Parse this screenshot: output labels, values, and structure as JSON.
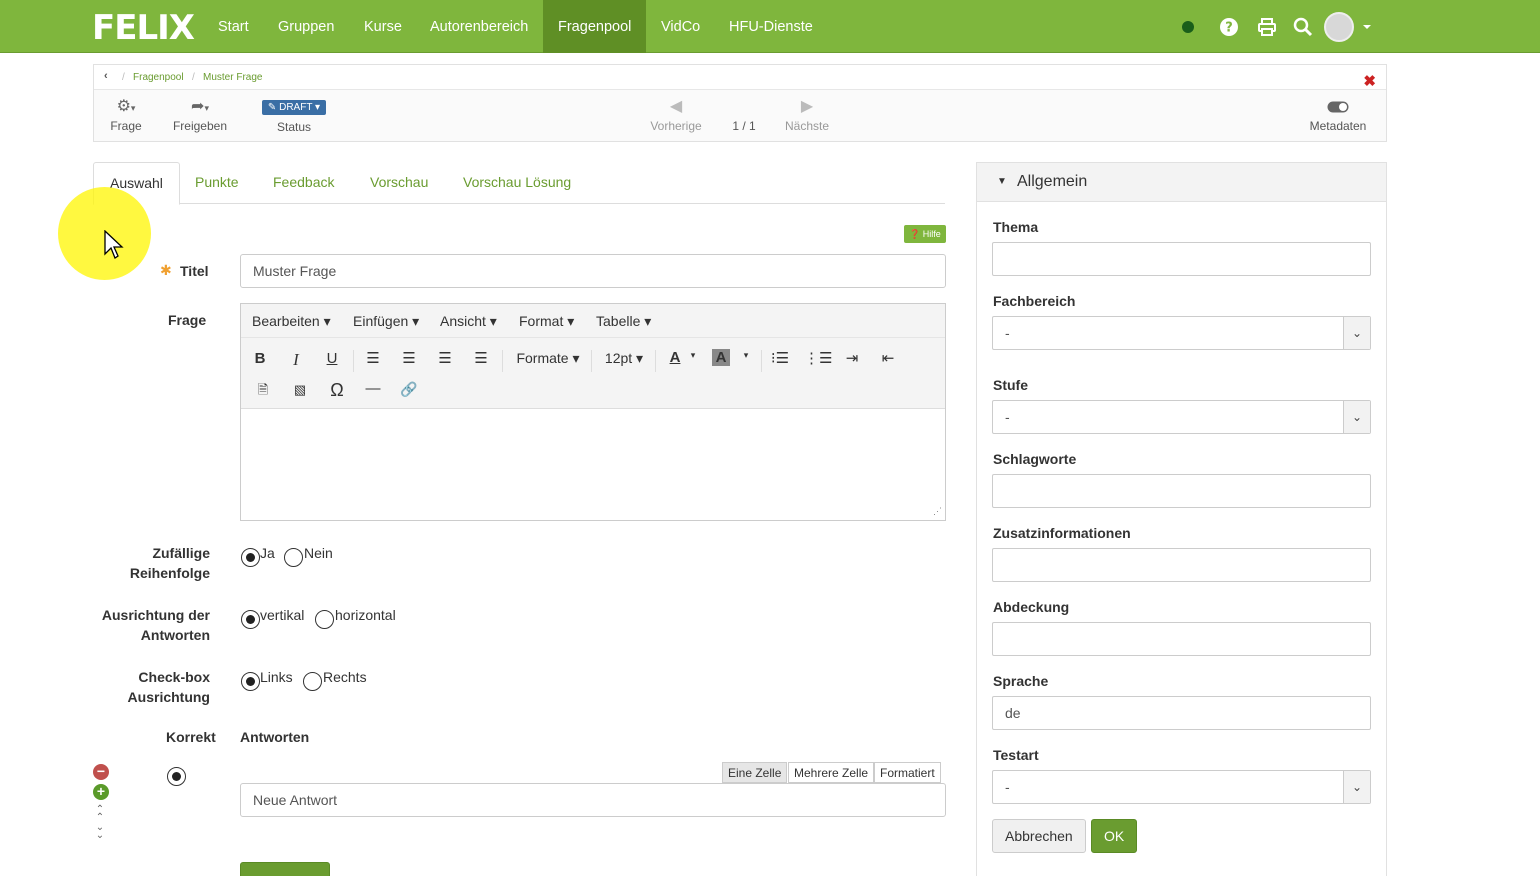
{
  "navbar": {
    "brand": "FELIX",
    "items": [
      {
        "label": "Start"
      },
      {
        "label": "Gruppen"
      },
      {
        "label": "Kurse"
      },
      {
        "label": "Autorenbereich"
      },
      {
        "label": "Fragenpool",
        "active": true
      },
      {
        "label": "VidCo"
      },
      {
        "label": "HFU-Dienste"
      }
    ],
    "icons": [
      "status-dot-icon",
      "help-icon",
      "print-icon",
      "search-icon",
      "avatar-icon",
      "caret-down-icon"
    ]
  },
  "breadcrumb": {
    "items": [
      "Fragenpool",
      "Muster Frage"
    ]
  },
  "toolbar": {
    "frage_label": "Frage",
    "freigeben_label": "Freigeben",
    "status_badge": "DRAFT",
    "status_label": "Status",
    "prev_label": "Vorherige",
    "counter": "1 / 1",
    "next_label": "Nächste",
    "metadata_label": "Metadaten"
  },
  "tabs": [
    "Auswahl",
    "Punkte",
    "Feedback",
    "Vorschau",
    "Vorschau Lösung"
  ],
  "form": {
    "hilfe": "Hilfe",
    "titel_label": "Titel",
    "titel_value": "Muster Frage",
    "frage_label": "Frage",
    "editor_menu": [
      "Bearbeiten",
      "Einfügen",
      "Ansicht",
      "Format",
      "Tabelle"
    ],
    "formate_label": "Formate",
    "fontsize_label": "12pt",
    "random_label_1": "Zufällige",
    "random_label_2": "Reihenfolge",
    "random_yes": "Ja",
    "random_no": "Nein",
    "orient_label_1": "Ausrichtung der",
    "orient_label_2": "Antworten",
    "orient_vert": "vertikal",
    "orient_horiz": "horizontal",
    "checkbox_label_1": "Check-box",
    "checkbox_label_2": "Ausrichtung",
    "checkbox_left": "Links",
    "checkbox_right": "Rechts",
    "korrekt_label": "Korrekt",
    "antworten_label": "Antworten",
    "mode_single": "Eine Zelle",
    "mode_multi": "Mehrere Zelle",
    "mode_formatted": "Formatiert",
    "answer_value": "Neue Antwort"
  },
  "panel": {
    "title": "Allgemein",
    "thema_label": "Thema",
    "fachbereich_label": "Fachbereich",
    "fachbereich_value": "-",
    "stufe_label": "Stufe",
    "stufe_value": "-",
    "schlagworte_label": "Schlagworte",
    "zusatz_label": "Zusatzinformationen",
    "abdeckung_label": "Abdeckung",
    "sprache_label": "Sprache",
    "sprache_value": "de",
    "testart_label": "Testart",
    "testart_value": "-",
    "cancel_label": "Abbrechen",
    "ok_label": "OK"
  },
  "colors": {
    "brand_green": "#7fb63d",
    "active_nav": "#5f8f25",
    "link_green": "#6a9c30",
    "draft_blue": "#3a6ea5",
    "close_red": "#cc2222",
    "cursor_highlight": "#fff500"
  }
}
